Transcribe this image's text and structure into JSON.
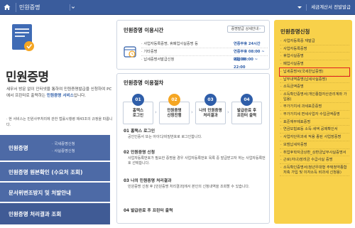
{
  "topbar": {
    "title": "민원증명",
    "right_link": "세금계산서 전발발급"
  },
  "intro": {
    "big_title": "민원증명",
    "desc_pre": "세무서 방문 없이 인터넷을 통하여 민원증명발급을 신청하여 PC에서 프린터로 출력하는 ",
    "desc_highlight": "민원증명 서비스",
    "desc_post": "입니다.",
    "note": "· 현 서비스는 민원사무처리에 관한 법률시행령 제43조의 규정을 따릅니다."
  },
  "left_nav": {
    "items": [
      {
        "label": "민원증명",
        "subs": [
          "국세증명신청",
          "사실증명신청"
        ]
      },
      {
        "label": "민원증명 원본확인 (수요처 조회)"
      },
      {
        "label": "문서위변조방지 및 처발안내"
      },
      {
        "label": "민원증명 처리결과 조회"
      }
    ]
  },
  "hours": {
    "title": "민원증명 이용시간",
    "button": "증명발급 상세안내",
    "rows": [
      {
        "key": "사업자등록증명, 휴폐업사실증명 등",
        "value_label": "연중무휴",
        "value": "24시간"
      },
      {
        "key": "기타증명",
        "value_label": "연중무휴",
        "value": "08:00 ~ 22:00"
      },
      {
        "key": "납세증명서발급신청",
        "value_label": "매일",
        "value": "08:00 ~ 22:00"
      }
    ]
  },
  "procedure": {
    "title": "민원증명 이용절차",
    "steps": [
      {
        "num": "01",
        "line1": "홈택스",
        "line2": "로그인"
      },
      {
        "num": "02",
        "line1": "민원증명",
        "line2": "신청진행"
      },
      {
        "num": "03",
        "line1": "나의 민원증명",
        "line2": "처리결과"
      },
      {
        "num": "04",
        "line1": "발급완료 후",
        "line2": "프린터 출력"
      }
    ],
    "details": [
      {
        "head": "01 홈택스 로그인",
        "desc": "공인인증서 또는 아이디/비밀번호로 로그인합니다."
      },
      {
        "head": "02 민원증명 신청",
        "desc": "사업자등록번호가 필요한 증명을 경우 사업자등록번호 목록 중 발급받고자 하는 사업자등록번호 선택합니다."
      },
      {
        "head": "03 나의 민원증명 처리결과",
        "desc": "민원증명 신청 후 [민원증명 처리결과]에서 본인의 신청내역을 조회할 수 있습니다."
      },
      {
        "head": "04 발급완료 후 프린터 출력",
        "desc": ""
      }
    ]
  },
  "apply": {
    "title": "민원증명신청",
    "items": [
      "사업자등록증 재발급",
      "사업자등록증명",
      "휴업사실증명",
      "폐업사실증명",
      "납세증명서(국세완납증명)",
      "납부내역증명(납세사실증명)",
      "소득금액증명",
      "소득확인증명서(개인종합자산관리계좌 가입용)",
      "부가가치세 과세표준증명",
      "부가가치세 면세사업자 수입금액증명",
      "표준재무제표증명",
      "연금보험료등 소득·세액 공제확인서",
      "사업자단위과세 적용 종된 사업장증명",
      "모범납세자증명",
      "취업후학자금상환_상환금납부사실증명서",
      "근로(자녀)장려금 수급사실 증명",
      "소득확인증명서(청년우대형 주택청약종합저축 가입 및 이자소득 비과세 신청용)"
    ],
    "highlighted_index": 4
  },
  "colors": {
    "topbar": "#3a5c9c",
    "nav": "#4d6aa6",
    "accent_blue": "#2f5ea9",
    "accent_orange": "#f5a623",
    "apply_bg": "#f8d14a",
    "highlight_border": "#e02020"
  }
}
